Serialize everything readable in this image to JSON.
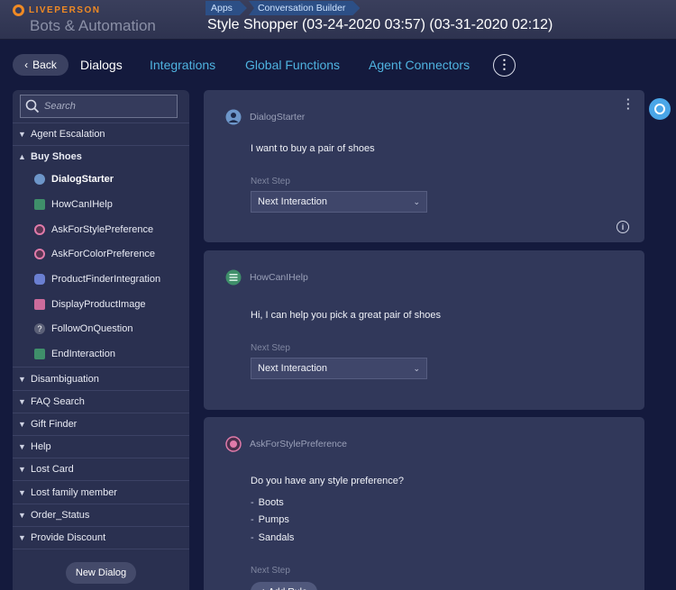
{
  "header": {
    "brand": "LIVEPERSON",
    "product": "Bots & Automation",
    "breadcrumbs": [
      "Apps",
      "Conversation Builder"
    ],
    "bot_title": "Style Shopper (03-24-2020 03:57) (03-31-2020 02:12)"
  },
  "nav": {
    "back_label": "Back",
    "tabs": [
      "Dialogs",
      "Integrations",
      "Global Functions",
      "Agent Connectors"
    ],
    "more_label": "⋮"
  },
  "sidebar": {
    "search_placeholder": "Search",
    "groups_top": [
      {
        "label": "Agent Escalation"
      },
      {
        "label": "Buy Shoes"
      }
    ],
    "buy_shoes_dialogs": [
      {
        "label": "DialogStarter",
        "icon": "user-icon"
      },
      {
        "label": "HowCanIHelp",
        "icon": "text-icon"
      },
      {
        "label": "AskForStylePreference",
        "icon": "multiple-choice-icon"
      },
      {
        "label": "AskForColorPreference",
        "icon": "multiple-choice-icon"
      },
      {
        "label": "ProductFinderIntegration",
        "icon": "cloud-icon"
      },
      {
        "label": "DisplayProductImage",
        "icon": "image-icon"
      },
      {
        "label": "FollowOnQuestion",
        "icon": "question-icon"
      },
      {
        "label": "EndInteraction",
        "icon": "text-icon"
      }
    ],
    "groups_bottom": [
      {
        "label": "Disambiguation"
      },
      {
        "label": "FAQ Search"
      },
      {
        "label": "Gift Finder"
      },
      {
        "label": "Help"
      },
      {
        "label": "Lost Card"
      },
      {
        "label": "Lost family member"
      },
      {
        "label": "Order_Status"
      },
      {
        "label": "Provide Discount"
      }
    ],
    "new_dialog_label": "New Dialog"
  },
  "cards": [
    {
      "name": "DialogStarter",
      "text": "I want to buy a pair of shoes",
      "next_step_label": "Next Step",
      "next_step_value": "Next Interaction"
    },
    {
      "name": "HowCanIHelp",
      "text": "Hi, I can help you pick a great pair of shoes",
      "next_step_label": "Next Step",
      "next_step_value": "Next Interaction"
    },
    {
      "name": "AskForStylePreference",
      "text": "Do you have any style preference?",
      "options": [
        "Boots",
        "Pumps",
        "Sandals"
      ],
      "next_step_label": "Next Step",
      "add_rule_label": "+ Add Rule"
    }
  ],
  "colors": {
    "background": "#141a3d",
    "accent": "#4fb3e0",
    "brand": "#f08a24"
  }
}
